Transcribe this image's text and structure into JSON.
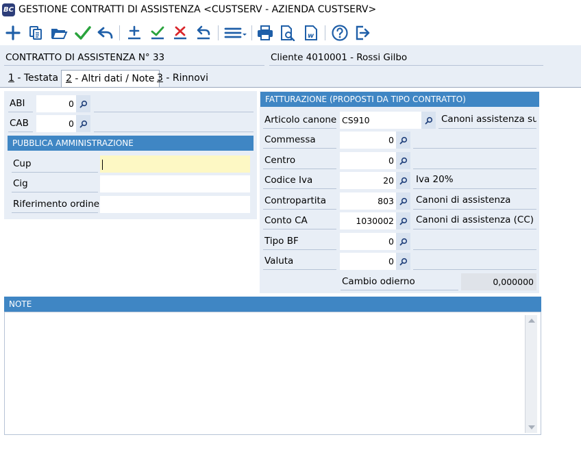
{
  "window": {
    "title": "GESTIONE CONTRATTI DI ASSISTENZA <CUSTSERV - AZIENDA CUSTSERV>",
    "logo_text": "BC"
  },
  "toolbar": {
    "icons": [
      "plus-icon",
      "copy-icon",
      "folder-open-icon",
      "check-icon",
      "undo-icon",
      "add-row-icon",
      "confirm-row-icon",
      "delete-row-icon",
      "undo-row-icon",
      "menu-icon",
      "print-icon",
      "print-preview-icon",
      "word-doc-icon",
      "help-icon",
      "exit-icon"
    ],
    "colors": {
      "blue": "#1f5fa8",
      "green": "#2aa33d",
      "red": "#d9262b"
    }
  },
  "header": {
    "contract": "CONTRATTO DI ASSISTENZA N° 33",
    "client": "Cliente 4010001 - Rossi Gilbo"
  },
  "tabs": [
    {
      "key": "1",
      "label": " - Testata"
    },
    {
      "key": "2",
      "label": " - Altri dati / Note"
    },
    {
      "key": "3",
      "label": " - Rinnovi"
    }
  ],
  "active_tab": 1,
  "bank": {
    "abi_label": "ABI",
    "abi_value": "0",
    "cab_label": "CAB",
    "cab_value": "0"
  },
  "pa": {
    "title": "PUBBLICA AMMINISTRAZIONE",
    "cup_label": "Cup",
    "cup_value": "",
    "cig_label": "Cig",
    "cig_value": "",
    "rif_label": "Riferimento ordine",
    "rif_value": ""
  },
  "billing": {
    "title": "FATTURAZIONE (PROPOSTI DA TIPO CONTRATTO)",
    "rows": [
      {
        "label": "Articolo canone",
        "value": "CS910",
        "desc": "Canoni assistenza su"
      },
      {
        "label": "Commessa",
        "value": "0",
        "desc": ""
      },
      {
        "label": "Centro",
        "value": "0",
        "desc": ""
      },
      {
        "label": "Codice Iva",
        "value": "20",
        "desc": "Iva 20%"
      },
      {
        "label": "Contropartita",
        "value": "803",
        "desc": "Canoni di assistenza"
      },
      {
        "label": "Conto CA",
        "value": "1030002",
        "desc": "Canoni di assistenza (CC)"
      },
      {
        "label": "Tipo BF",
        "value": "0",
        "desc": ""
      },
      {
        "label": "Valuta",
        "value": "0",
        "desc": ""
      }
    ],
    "exchange_label": "Cambio odierno",
    "exchange_value": "0,000000"
  },
  "notes": {
    "title": "NOTE",
    "text": ""
  },
  "colors": {
    "section_header": "#3f86c4",
    "panel_bg": "#e8eef6",
    "highlight_input": "#fdf8c4"
  }
}
